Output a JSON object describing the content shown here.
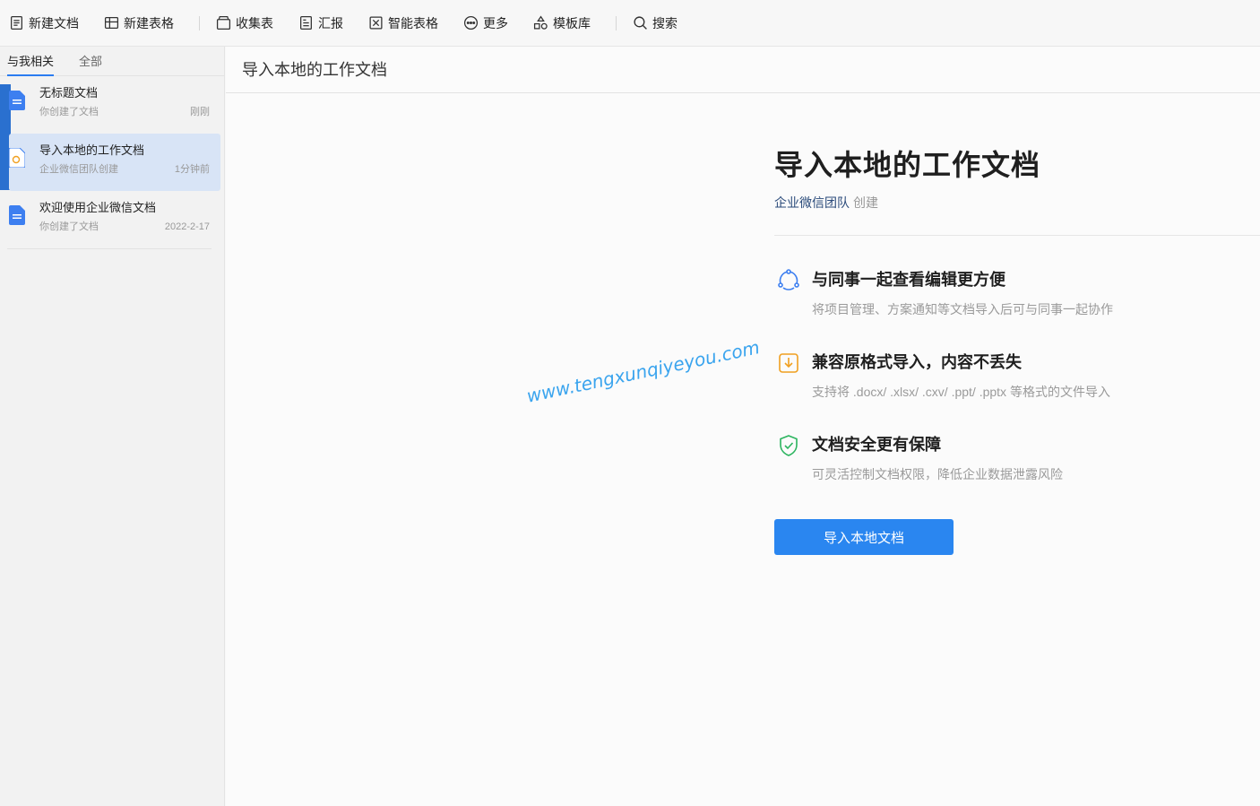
{
  "toolbar": {
    "items": [
      {
        "label": "新建文档",
        "icon": "new-doc-icon"
      },
      {
        "label": "新建表格",
        "icon": "new-sheet-icon"
      },
      {
        "label": "收集表",
        "icon": "form-icon"
      },
      {
        "label": "汇报",
        "icon": "report-icon"
      },
      {
        "label": "智能表格",
        "icon": "smart-sheet-icon"
      },
      {
        "label": "更多",
        "icon": "more-icon"
      },
      {
        "label": "模板库",
        "icon": "template-icon"
      },
      {
        "label": "搜索",
        "icon": "search-icon"
      }
    ]
  },
  "sidebar": {
    "tabs": [
      {
        "label": "与我相关",
        "active": true
      },
      {
        "label": "全部",
        "active": false
      }
    ],
    "docs": [
      {
        "title": "无标题文档",
        "meta": "你创建了文档",
        "time": "刚刚"
      },
      {
        "title": "导入本地的工作文档",
        "meta": "企业微信团队创建",
        "time": "1分钟前",
        "selected": true
      },
      {
        "title": "欢迎使用企业微信文档",
        "meta": "你创建了文档",
        "time": "2022-2-17"
      }
    ]
  },
  "main": {
    "header_title": "导入本地的工作文档",
    "card": {
      "title": "导入本地的工作文档",
      "team": "企业微信团队",
      "created": "创建",
      "features": [
        {
          "title": "与同事一起查看编辑更方便",
          "desc": "将项目管理、方案通知等文档导入后可与同事一起协作",
          "icon": "share-icon"
        },
        {
          "title": "兼容原格式导入，内容不丢失",
          "desc": "支持将 .docx/ .xlsx/ .cxv/ .ppt/ .pptx 等格式的文件导入",
          "icon": "import-icon"
        },
        {
          "title": "文档安全更有保障",
          "desc": "可灵活控制文档权限，降低企业数据泄露风险",
          "icon": "shield-icon"
        }
      ],
      "button_label": "导入本地文档"
    }
  },
  "watermark": "www.tengxunqiyeyou.com",
  "colors": {
    "accent": "#2a86f0",
    "selected_bg": "#d8e4f6"
  }
}
